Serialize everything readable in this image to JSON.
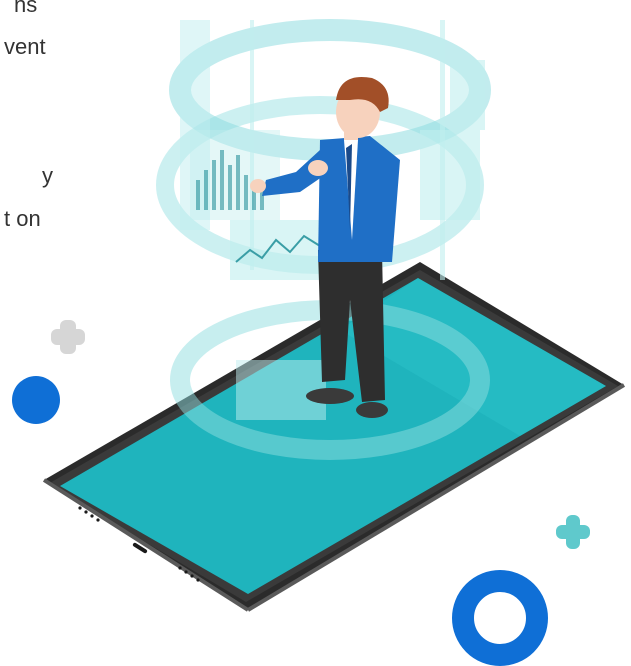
{
  "text_fragments": [
    "ns",
    "vent",
    "y",
    "t on"
  ],
  "colors": {
    "screen": "#1fb4bd",
    "phone_body": "#2b2b2b",
    "phone_edge": "#5a5a5a",
    "hologram": "#8fdde0",
    "shirt": "#1f6fc6",
    "pants": "#2e2e2e",
    "hair": "#a24f28",
    "skin": "#f7d2bd",
    "accent_blue": "#0f6fd6",
    "plus_gray": "#d6d6d6",
    "plus_teal": "#5fc9cc"
  },
  "icons": [
    "plus-icon-gray",
    "plus-icon-teal",
    "dot-blue",
    "ring-blue"
  ]
}
